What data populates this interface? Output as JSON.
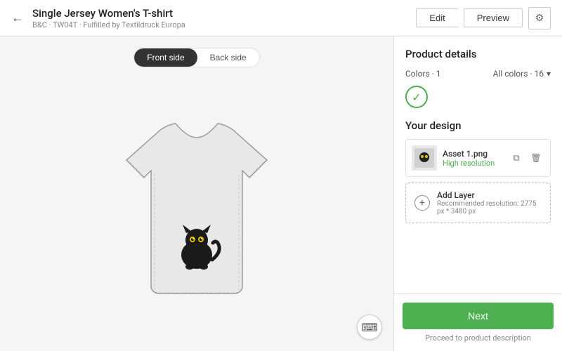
{
  "header": {
    "back_icon": "←",
    "title": "Single Jersey Women's T-shirt",
    "subtitle": "B&C · TW04T · Fulfilled by Textildruck Europa",
    "edit_label": "Edit",
    "preview_label": "Preview",
    "settings_icon": "⚙"
  },
  "canvas": {
    "front_side_label": "Front side",
    "back_side_label": "Back side",
    "keyboard_icon": "⌨"
  },
  "right_panel": {
    "product_details_title": "Product details",
    "colors_label": "Colors · 1",
    "all_colors_label": "All colors · 16",
    "chevron_icon": "▾",
    "your_design_title": "Your design",
    "asset": {
      "name": "Asset 1.png",
      "quality": "High resolution",
      "copy_icon": "⧉",
      "delete_icon": "🗑"
    },
    "add_layer": {
      "label": "Add Layer",
      "sublabel": "Recommended resolution: 2775 px * 3480 px",
      "plus_icon": "+"
    },
    "footer": {
      "next_label": "Next",
      "proceed_text": "Proceed to product description"
    }
  }
}
